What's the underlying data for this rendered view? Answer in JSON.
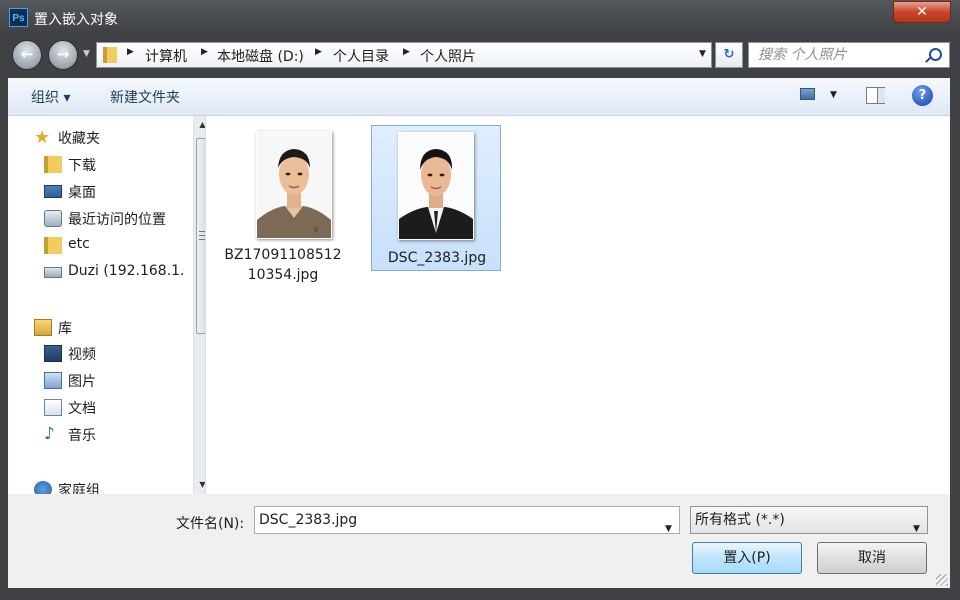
{
  "window": {
    "title": "置入嵌入对象",
    "app_icon": "Ps",
    "close_glyph": "✕"
  },
  "nav": {
    "back_glyph": "←",
    "forward_glyph": "→",
    "breadcrumbs": [
      "计算机",
      "本地磁盘 (D:)",
      "个人目录",
      "个人照片"
    ],
    "refresh_glyph": "↻",
    "search_placeholder": "搜索 个人照片"
  },
  "toolbar": {
    "organize_label": "组织 ▾",
    "new_folder_label": "新建文件夹",
    "help_glyph": "?"
  },
  "sidebar": {
    "items": [
      {
        "label": "收藏夹",
        "icon": "star-icon"
      },
      {
        "label": "下载",
        "icon": "download-folder-icon"
      },
      {
        "label": "桌面",
        "icon": "desktop-icon"
      },
      {
        "label": "最近访问的位置",
        "icon": "recent-places-icon"
      },
      {
        "label": "etc",
        "icon": "folder-icon"
      },
      {
        "label": "Duzi (192.168.1.",
        "icon": "network-drive-icon"
      },
      {
        "label": "库",
        "icon": "library-icon"
      },
      {
        "label": "视频",
        "icon": "video-icon"
      },
      {
        "label": "图片",
        "icon": "pictures-icon"
      },
      {
        "label": "文档",
        "icon": "documents-icon"
      },
      {
        "label": "音乐",
        "icon": "music-icon"
      },
      {
        "label": "家庭组",
        "icon": "homegroup-icon"
      }
    ]
  },
  "files": [
    {
      "name_line1": "BZ17091108512",
      "name_line2": "10354.jpg",
      "selected": false
    },
    {
      "name_line1": "DSC_2383.jpg",
      "name_line2": "",
      "selected": true
    }
  ],
  "bottom": {
    "filename_label": "文件名(N):",
    "filename_value": "DSC_2383.jpg",
    "filetype_value": "所有格式 (*.*)",
    "place_button": "置入(P)",
    "cancel_button": "取消"
  },
  "colors": {
    "selection_fill": "#cce4fb",
    "selection_border": "#84acdd",
    "title_bar": "#3f4144",
    "close_red": "#c8452c"
  }
}
